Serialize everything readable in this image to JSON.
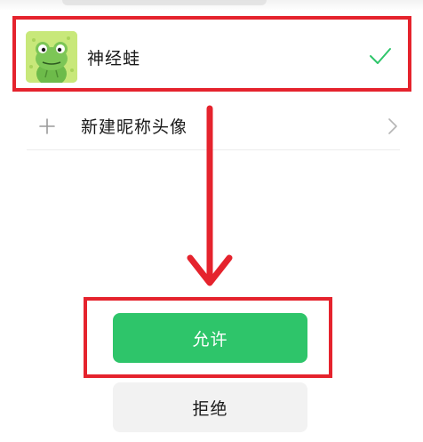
{
  "profile": {
    "name": "神经蛙",
    "avatar_icon": "frog-avatar-icon",
    "selected_icon": "check-icon"
  },
  "new_profile": {
    "label": "新建昵称头像",
    "icon": "plus-icon",
    "trailing_icon": "chevron-right-icon"
  },
  "actions": {
    "allow_label": "允许",
    "reject_label": "拒绝"
  },
  "colors": {
    "accent_green": "#2ec56a",
    "annotation_red": "#e5232d",
    "secondary_button_bg": "#f2f2f2"
  }
}
